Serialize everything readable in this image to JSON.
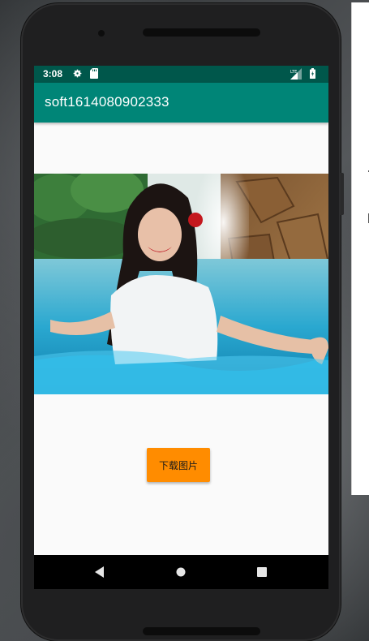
{
  "status_bar": {
    "time": "3:08",
    "icons": [
      "gear-icon",
      "sd-card-icon",
      "lte-signal-icon",
      "battery-icon"
    ],
    "color": "#00574b"
  },
  "app_bar": {
    "title": "soft1614080902333",
    "color": "#008577"
  },
  "content": {
    "image": "photo-woman-in-pool-waterfall",
    "download_button_label": "下载图片",
    "button_color": "#ff8c00"
  },
  "nav_bar": {
    "icons": [
      "back-icon",
      "home-icon",
      "recents-icon"
    ]
  }
}
